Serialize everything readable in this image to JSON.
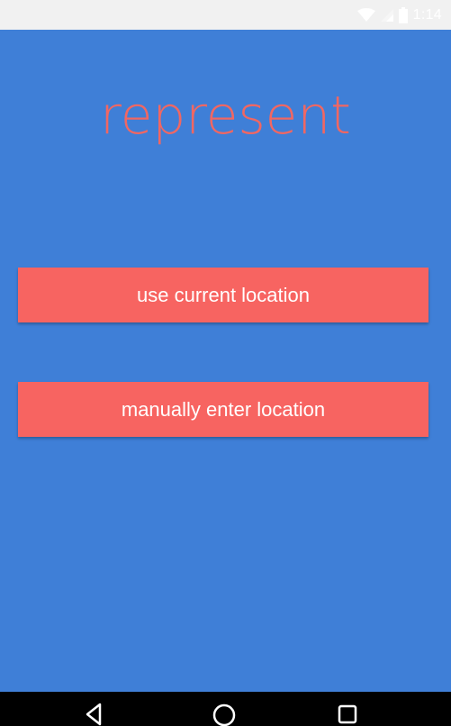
{
  "status_bar": {
    "time": "1:14",
    "icons": [
      "wifi-icon",
      "signal-icon",
      "battery-icon"
    ]
  },
  "app": {
    "title": "represent",
    "buttons": {
      "current_location": "use current location",
      "manual_location": "manually enter location"
    }
  },
  "nav_bar": {
    "icons": [
      "back-icon",
      "home-icon",
      "recents-icon"
    ]
  },
  "colors": {
    "background": "#3f7fd7",
    "accent": "#f76461",
    "title": "#f06763",
    "status_bar": "#f1f1f1",
    "nav_bar": "#000000"
  }
}
